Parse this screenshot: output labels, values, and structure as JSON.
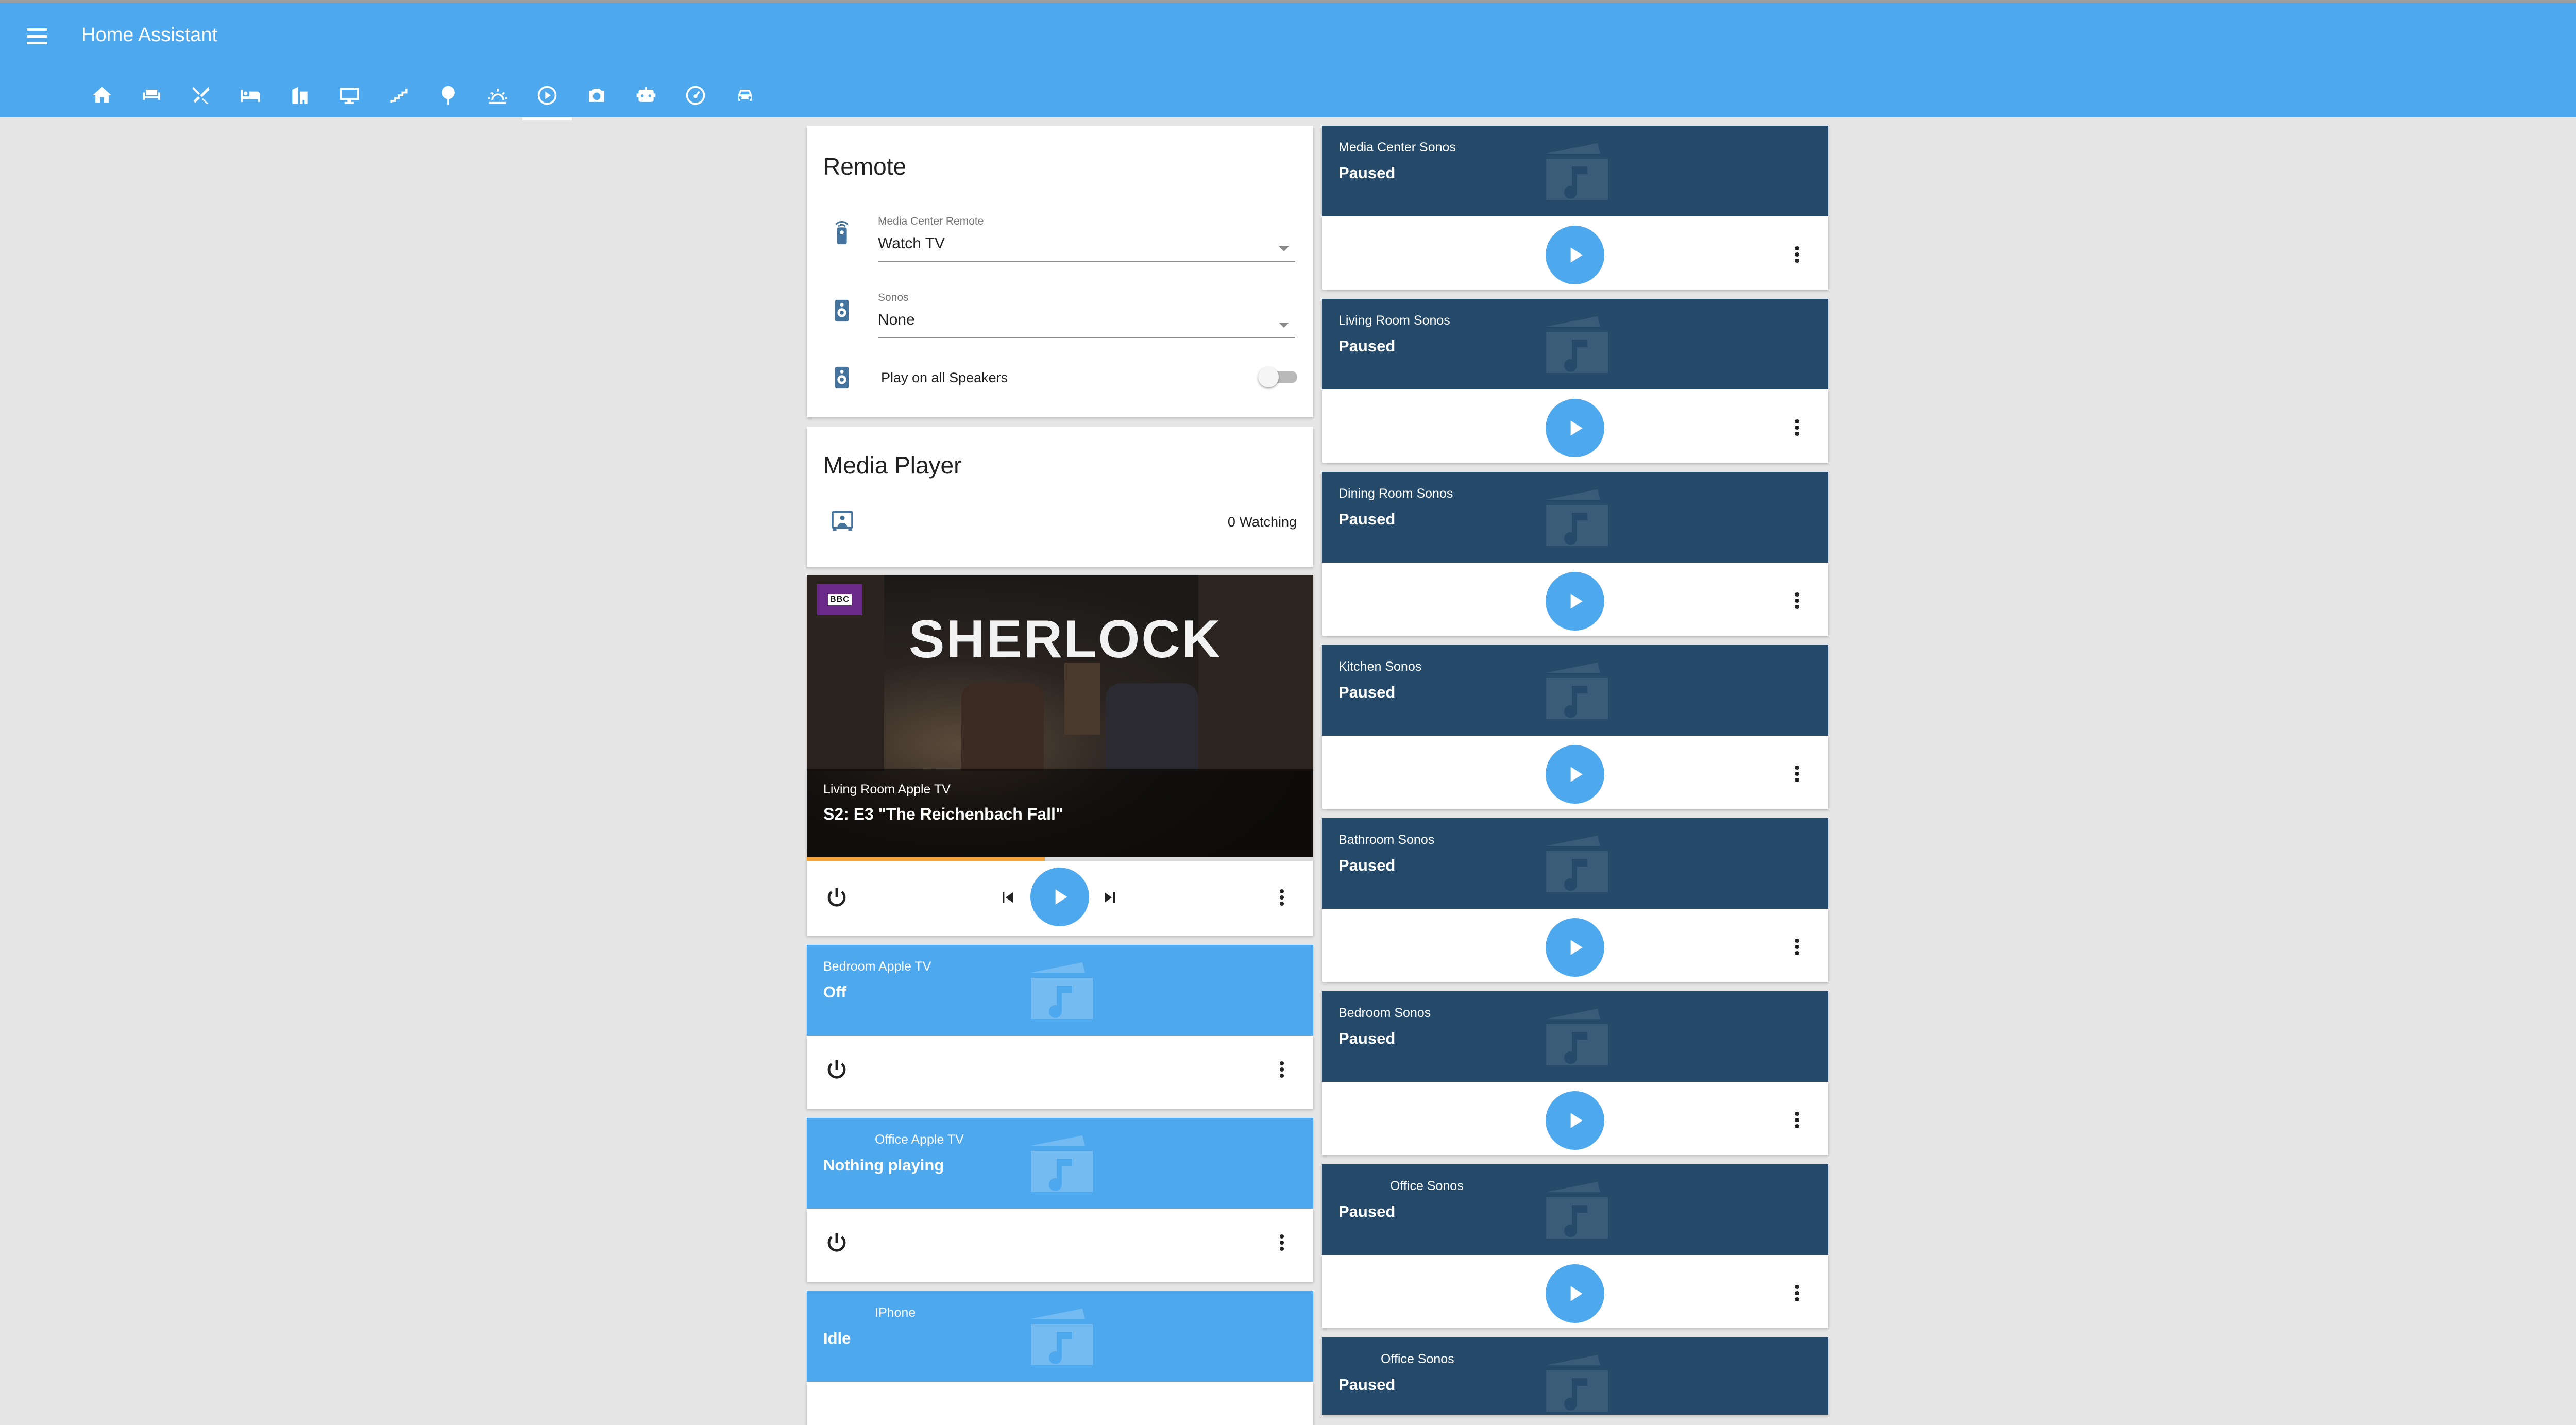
{
  "app": {
    "title": "Home Assistant"
  },
  "nav": {
    "tabs": [
      {
        "icon": "home-icon"
      },
      {
        "icon": "sofa-icon"
      },
      {
        "icon": "silverware-icon"
      },
      {
        "icon": "bed-icon"
      },
      {
        "icon": "garage-icon"
      },
      {
        "icon": "monitor-icon"
      },
      {
        "icon": "stairs-icon"
      },
      {
        "icon": "tree-icon"
      },
      {
        "icon": "weather-sunset-icon"
      },
      {
        "icon": "play-circle-icon"
      },
      {
        "icon": "camera-icon"
      },
      {
        "icon": "robot-icon"
      },
      {
        "icon": "gauge-icon"
      },
      {
        "icon": "car-icon"
      }
    ],
    "active_tab": "play-circle-icon"
  },
  "remote_card": {
    "title": "Remote",
    "media_center_remote": {
      "label": "Media Center Remote",
      "value": "Watch TV"
    },
    "sonos": {
      "label": "Sonos",
      "value": "None"
    },
    "play_all": {
      "label": "Play on all Speakers",
      "on": false
    }
  },
  "media_player_card": {
    "title": "Media Player",
    "watching": "0 Watching"
  },
  "now_playing": {
    "artwork_title": "SHERLOCK",
    "artwork_badge": "BBC",
    "device": "Living Room Apple TV",
    "episode": "S2: E3 \"The Reichenbach Fall\"",
    "progress_fraction": 0.47
  },
  "left_players": [
    {
      "name": "Bedroom Apple TV",
      "state": "Off"
    },
    {
      "name": "Office Apple TV",
      "state": "Nothing playing"
    },
    {
      "name": "IPhone",
      "state": "Idle"
    }
  ],
  "right_players": [
    {
      "name": "Media Center Sonos",
      "state": "Paused"
    },
    {
      "name": "Living Room Sonos",
      "state": "Paused"
    },
    {
      "name": "Dining Room Sonos",
      "state": "Paused"
    },
    {
      "name": "Kitchen Sonos",
      "state": "Paused"
    },
    {
      "name": "Bathroom Sonos",
      "state": "Paused"
    },
    {
      "name": "Bedroom Sonos",
      "state": "Paused"
    },
    {
      "name": "Office Sonos",
      "state": "Paused"
    },
    {
      "name": "Office Sonos",
      "state": "Paused"
    }
  ],
  "colors": {
    "header": "#4ea8ee",
    "apple_tv_card": "#4ea8ee",
    "sonos_card": "#254a6a",
    "progress": "#f3a13a"
  }
}
